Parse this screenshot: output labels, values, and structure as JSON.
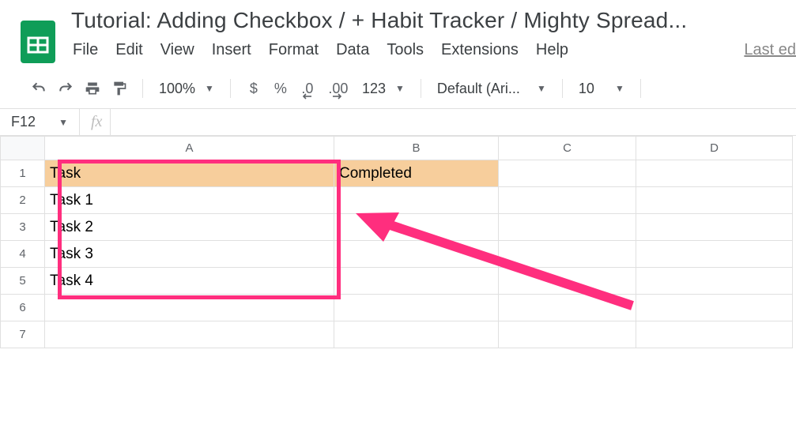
{
  "doc_title": "Tutorial: Adding Checkbox / + Habit Tracker / Mighty Spread...",
  "menu": {
    "file": "File",
    "edit": "Edit",
    "view": "View",
    "insert": "Insert",
    "format": "Format",
    "data": "Data",
    "tools": "Tools",
    "extensions": "Extensions",
    "help": "Help",
    "last": "Last ed"
  },
  "toolbar": {
    "zoom": "100%",
    "dollar": "$",
    "percent": "%",
    "dec_dec": ".0",
    "dec_inc": ".00",
    "num_fmt": "123",
    "font": "Default (Ari...",
    "size": "10"
  },
  "namebox": "F12",
  "fx_label": "fx",
  "columns": [
    "A",
    "B",
    "C",
    "D"
  ],
  "rows": [
    "1",
    "2",
    "3",
    "4",
    "5",
    "6",
    "7"
  ],
  "cells": {
    "A1": "Task",
    "B1": "Completed",
    "A2": "Task 1",
    "A3": "Task 2",
    "A4": "Task 3",
    "A5": "Task 4"
  }
}
